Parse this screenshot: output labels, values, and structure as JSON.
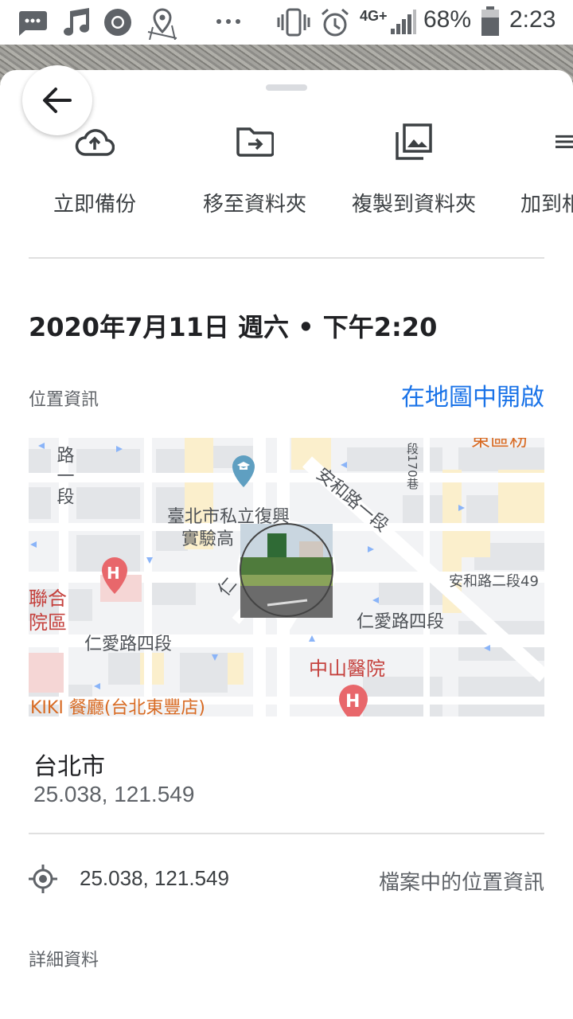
{
  "status_bar": {
    "battery": "68%",
    "time": "2:23",
    "network": "4G+",
    "icons": [
      "message-icon",
      "music-icon",
      "chrome-icon",
      "location-pin-icon",
      "more-icon",
      "vibrate-icon",
      "alarm-icon",
      "signal-icon",
      "battery-icon"
    ]
  },
  "actions": [
    {
      "label": "立即備份",
      "icon": "cloud-upload-icon"
    },
    {
      "label": "移至資料夾",
      "icon": "move-to-folder-icon"
    },
    {
      "label": "複製到資料夾",
      "icon": "copy-to-folder-icon"
    },
    {
      "label": "加到相",
      "icon": "add-to-album-icon"
    }
  ],
  "datetime": "2020年7月11日 週六 • 下午2:20",
  "location": {
    "section_label": "位置資訊",
    "open_map_label": "在地圖中開啟",
    "map_labels": {
      "road_1": "路一段",
      "school": "臺北市私立復興",
      "school_line2": "實驗高",
      "anhe_road": "安和路一段",
      "lane": "段170巷",
      "top_right": "東區粉",
      "anhe_49": "安和路二段49",
      "renai_right": "仁愛路四段",
      "renai_left": "仁愛路四段",
      "lianhe": "聯合",
      "lianhe_line2": "院區",
      "zhongshan": "中山醫院",
      "kiki": "KIKI 餐廳(台北東豐店)",
      "ren": "仁"
    },
    "place_name": "台北市",
    "place_coords": "25.038, 121.549",
    "file_coords": "25.038, 121.549",
    "file_source_label": "檔案中的位置資訊"
  },
  "details_label": "詳細資料",
  "colors": {
    "accent": "#1a73e8",
    "hospital": "#e8676b",
    "school": "#5f9fc1",
    "poi_text": "#c5413d",
    "kiki_text": "#d86a22"
  }
}
